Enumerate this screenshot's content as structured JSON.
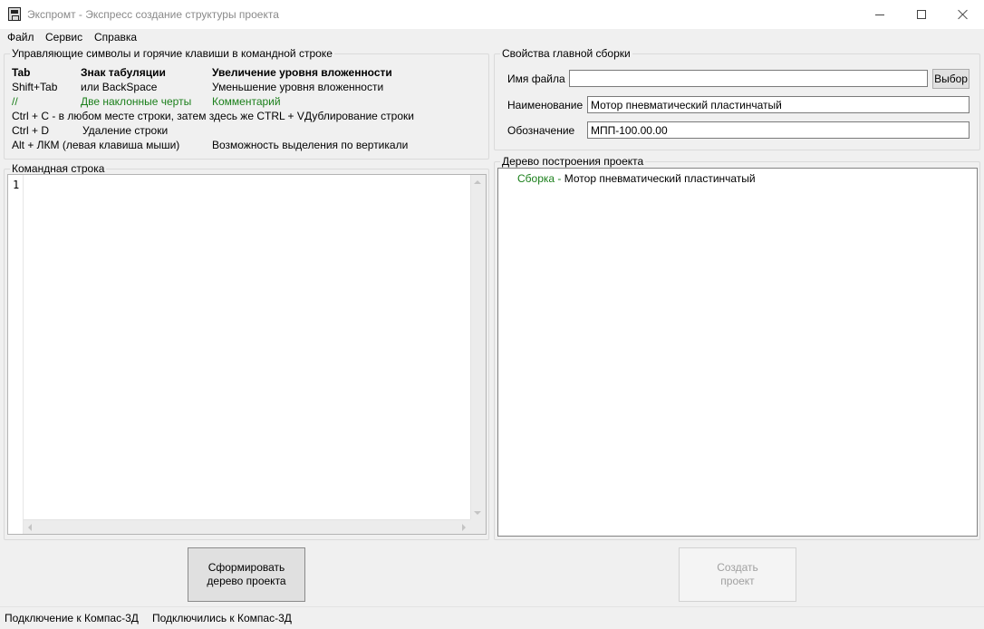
{
  "window": {
    "title": "Экспромт - Экспресс создание структуры проекта"
  },
  "menu": [
    "Файл",
    "Сервис",
    "Справка"
  ],
  "hotkeys": {
    "legend": "Управляющие символы и горячие клавиши в командной строке",
    "rows": [
      {
        "key": "Tab",
        "symbol": "Знак табуляции",
        "action": "Увеличение уровня вложенности"
      },
      {
        "key": "Shift+Tab",
        "symbol": "или BackSpace",
        "action": "Уменьшение уровня вложенности"
      },
      {
        "key": "//",
        "symbol": "Две наклонные черты",
        "action": "Комментарий"
      },
      {
        "key": "Ctrl + C - в любом месте строки, затем здесь же CTRL + V",
        "action": "Дублирование строки"
      },
      {
        "key": "Ctrl + D",
        "action": "Удаление строки"
      },
      {
        "key": "Alt + ЛКМ (левая клавиша мыши)",
        "action": "Возможность выделения по вертикали"
      }
    ]
  },
  "assembly": {
    "legend": "Свойства главной сборки",
    "file_label": "Имя файла",
    "file_value": "",
    "choose_button": "Выбор",
    "name_label": "Наименование",
    "name_value": "Мотор пневматический пластинчатый",
    "designation_label": "Обозначение",
    "designation_value": "МПП-100.00.00"
  },
  "command_line": {
    "legend": "Командная строка",
    "line_number": "1"
  },
  "tree": {
    "legend": "Дерево построения проекта",
    "root_type": "Сборка",
    "root_separator": " - ",
    "root_name": "Мотор пневматический пластинчатый"
  },
  "buttons": {
    "build_tree": [
      "Сформировать",
      "дерево проекта"
    ],
    "create_project": [
      "Создать",
      "проект"
    ]
  },
  "status": {
    "label": "Подключение к Компас-3Д",
    "value": "Подключились к Компас-3Д"
  },
  "colors": {
    "comment_green": "#1a7f1a",
    "disabled_text": "#a0a0a0"
  }
}
